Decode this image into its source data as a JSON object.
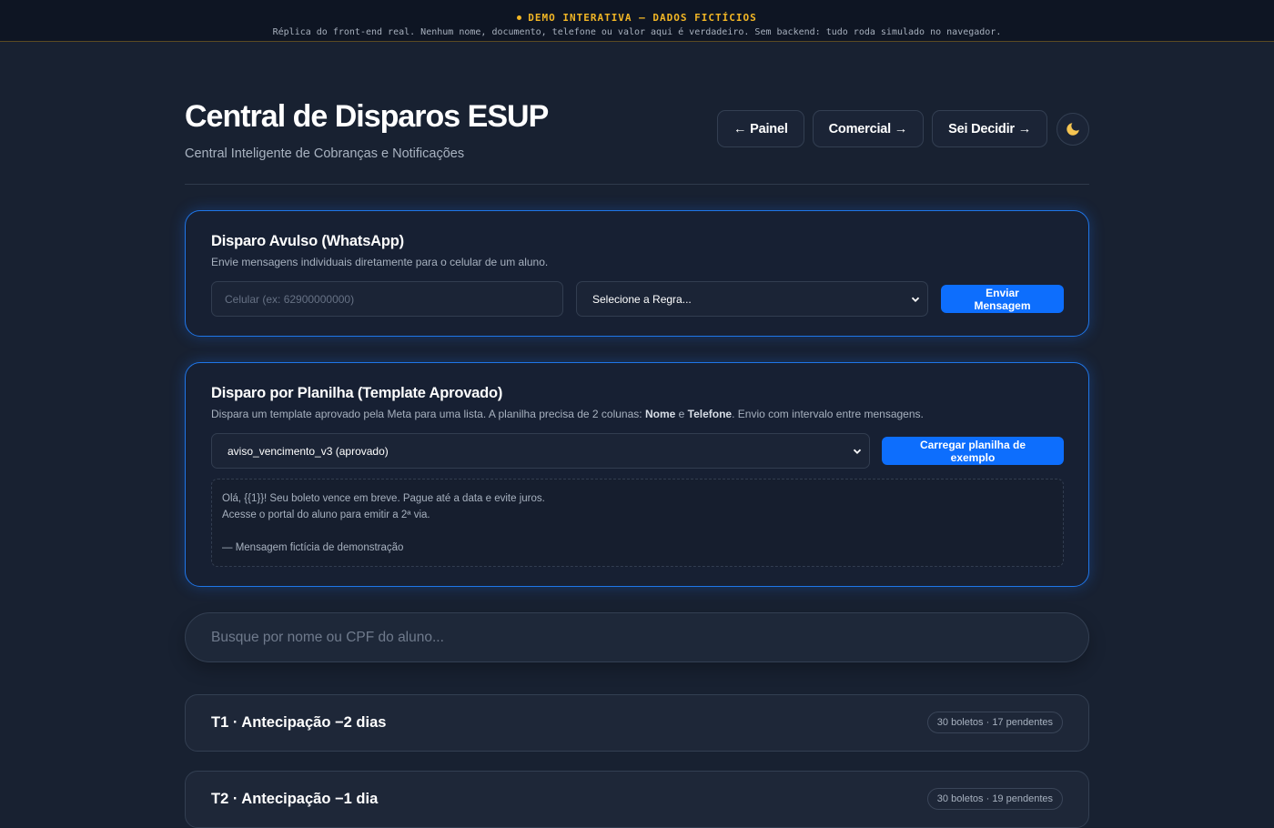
{
  "banner": {
    "title": "DEMO INTERATIVA — DADOS FICTÍCIOS",
    "subtitle": "Réplica do front-end real. Nenhum nome, documento, telefone ou valor aqui é verdadeiro. Sem backend: tudo roda simulado no navegador."
  },
  "header": {
    "title": "Central de Disparos ESUP",
    "subtitle": "Central Inteligente de Cobranças e Notificações",
    "nav": [
      {
        "label": "← Painel"
      },
      {
        "label": "Comercial →"
      },
      {
        "label": "Sei Decidir →"
      }
    ],
    "theme_icon": "moon-icon"
  },
  "avulso": {
    "title": "Disparo Avulso (WhatsApp)",
    "description": "Envie mensagens individuais diretamente para o celular de um aluno.",
    "phone_placeholder": "Celular (ex: 62900000000)",
    "rule_selected": "Selecione a Regra...",
    "send_label": "Enviar Mensagem"
  },
  "planilha": {
    "title": "Disparo por Planilha (Template Aprovado)",
    "description_pre": "Dispara um template aprovado pela Meta para uma lista. A planilha precisa de 2 colunas: ",
    "col1": "Nome",
    "description_mid": " e ",
    "col2": "Telefone",
    "description_post": ". Envio com intervalo entre mensagens.",
    "template_selected": "aviso_vencimento_v3 (aprovado)",
    "load_label": "Carregar planilha de exemplo",
    "preview_line1": "Olá, {{1}}! Seu boleto vence em breve. Pague até a data e evite juros.",
    "preview_line2": "Acesse o portal do aluno para emitir a 2ª via.",
    "preview_footer": "— Mensagem fictícia de demonstração"
  },
  "search": {
    "placeholder": "Busque por nome ou CPF do aluno..."
  },
  "groups": [
    {
      "title": "T1 · Antecipação −2 dias",
      "badge": "30 boletos · 17 pendentes"
    },
    {
      "title": "T2 · Antecipação −1 dia",
      "badge": "30 boletos · 19 pendentes"
    }
  ],
  "colors": {
    "accent": "#0d6efd",
    "warning": "#f2b625",
    "background": "#182131"
  }
}
